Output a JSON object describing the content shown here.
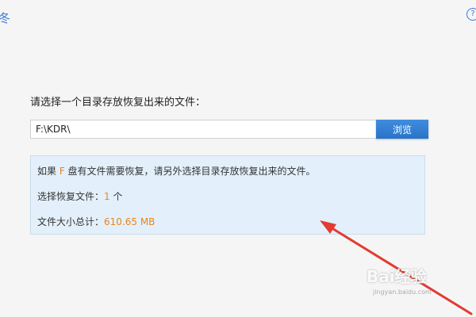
{
  "corner": {
    "left_glyph": "冬",
    "right_glyph": "?"
  },
  "prompt": "请选择一个目录存放恢复出来的文件：",
  "path_input": {
    "value": "F:\\KDR\\"
  },
  "browse_button": "浏览",
  "info": {
    "line1_prefix": "如果 ",
    "drive": "F",
    "line1_suffix": " 盘有文件需要恢复，请另外选择目录存放恢复出来的文件。",
    "selected_label": "选择恢复文件：",
    "selected_count": "1",
    "selected_unit": " 个",
    "size_label": "文件大小总计：",
    "size_value": "610.65 MB"
  },
  "watermark": {
    "main": "Bai经验",
    "sub": "jingyan.baidu.com"
  },
  "colors": {
    "accent": "#2a73c8",
    "highlight": "#e8851a",
    "annotation_arrow": "#e23b32",
    "info_bg": "#e3f0fb"
  }
}
